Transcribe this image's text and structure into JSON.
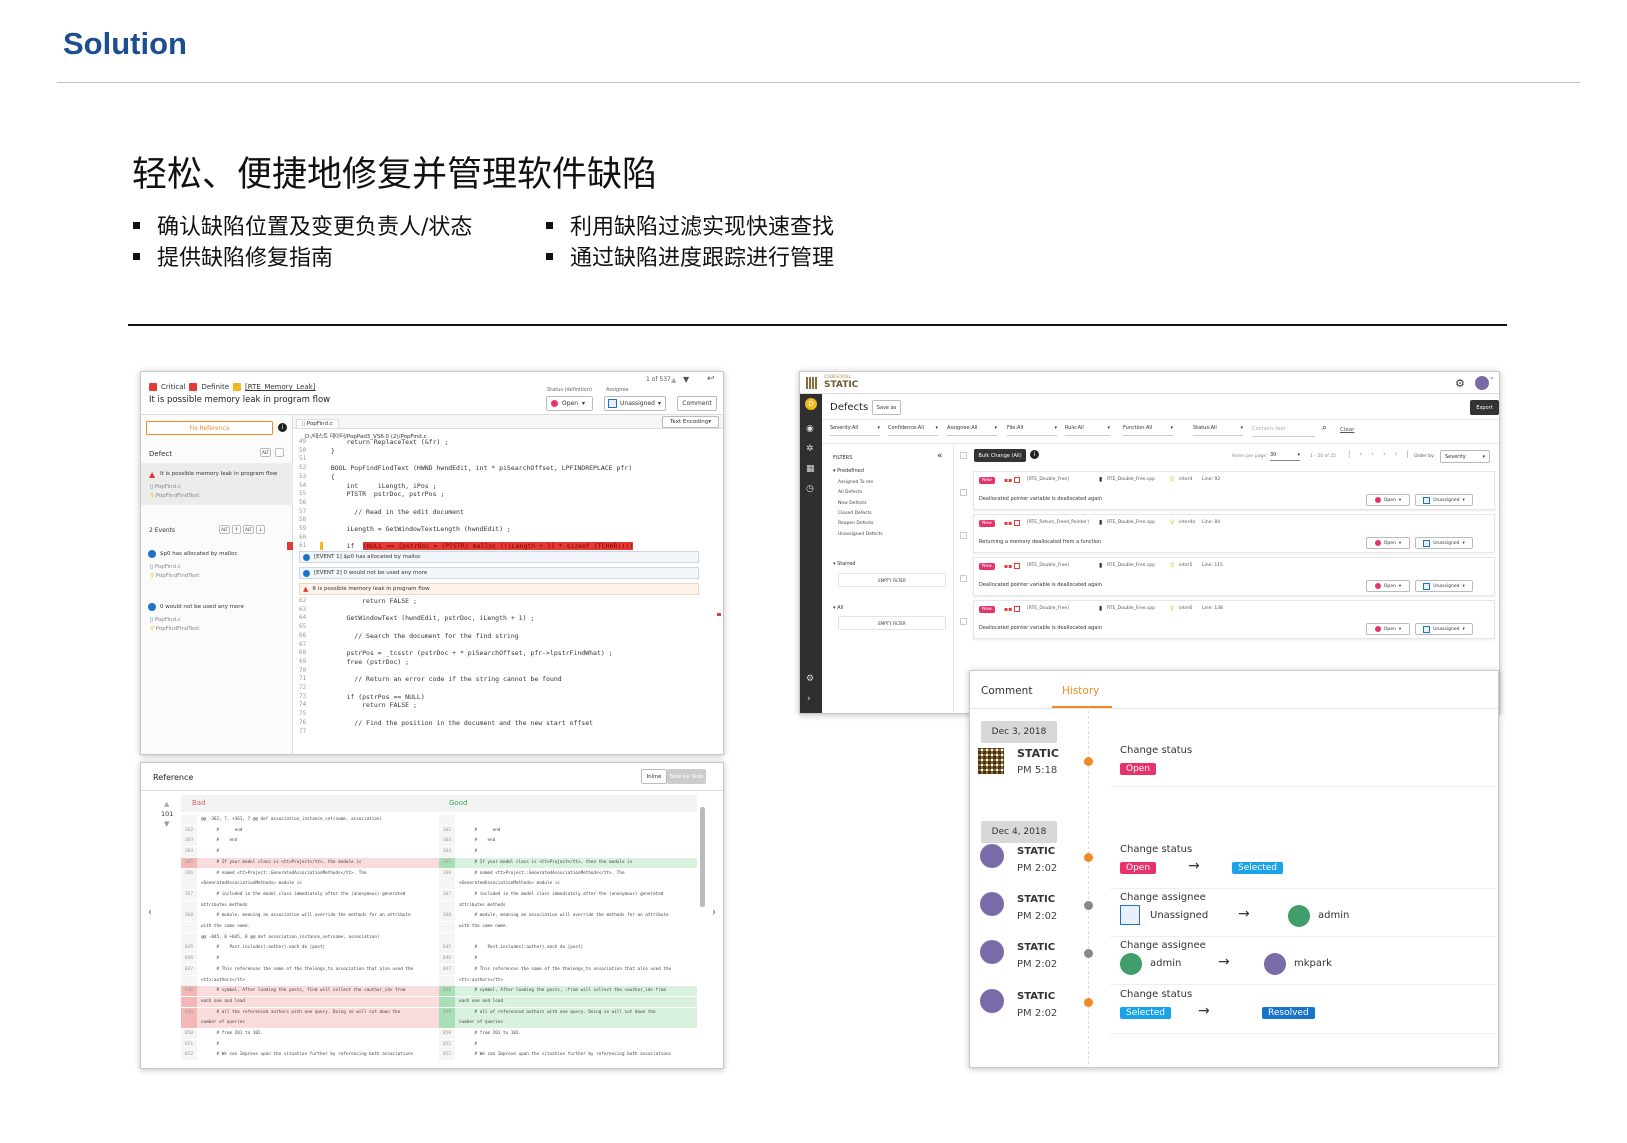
{
  "slide": {
    "title": "Solution",
    "headline": "轻松、便捷地修复并管理软件缺陷",
    "bullets": [
      "确认缺陷位置及变更负责人/状态",
      "提供缺陷修复指南",
      "利用缺陷过滤实现快速查找",
      "通过缺陷进度跟踪进行管理"
    ]
  },
  "left": {
    "tag_critical": "Critical",
    "tag_definite": "Definite",
    "checker": "[RTE_Memory_Leak]",
    "issue_title": "It is possible memory leak in program flow",
    "status_label": "Status",
    "status_sub": "(definition)",
    "assignee_label": "Assignee",
    "nav": "1 of 537",
    "status_value": "Open",
    "assignee_value": "Unassigned",
    "comment_btn": "Comment",
    "text_encoding": "Text Encoding",
    "fix_reference": "Fix Reference",
    "file_tab": "PopFind.c",
    "file_path": "D:/테스트 데이터/PopPad3_VS6.0 (2)/PopFind.c",
    "defect_label": "Defect",
    "defect_item": "It is possible memory leak in program flow",
    "file1": "PopFind.c",
    "func1": "PopFindFindText",
    "events_label": "2 Events",
    "event1": "$p0 has allocated by malloc",
    "file2": "PopFind.c",
    "func2": "PopFindFindText",
    "event2": "0 would not be used any more",
    "file3": "PopFind.c",
    "func3": "PopFindFindText",
    "code_top": [
      {
        "n": "49",
        "t": "      return ReplaceText (&fr) ;"
      },
      {
        "n": "50",
        "t": "  }"
      },
      {
        "n": "51",
        "t": ""
      },
      {
        "n": "52",
        "t": "  BOOL PopFindFindText (HWND hwndEdit, int * piSearchOffset, LPFINDREPLACE pfr)"
      },
      {
        "n": "53",
        "t": "  {"
      },
      {
        "n": "54",
        "t": "      int     iLength, iPos ;"
      },
      {
        "n": "55",
        "t": "      PTSTR  pstrDoc, pstrPos ;"
      },
      {
        "n": "56",
        "t": ""
      },
      {
        "n": "57",
        "t": "        // Read in the edit document"
      },
      {
        "n": "58",
        "t": ""
      },
      {
        "n": "59",
        "t": "      iLength = GetWindowTextLength (hwndEdit) ;"
      },
      {
        "n": "60",
        "t": ""
      }
    ],
    "line61_n": "61",
    "line61_if": "      if ",
    "line61_hl": "(NULL == (pstrDoc = (PTSTR) malloc ((iLength + 1) * sizeof (TCHAR))))",
    "evt_row1": "[EVENT 1] $p0 has allocated by malloc",
    "evt_row2": "[EVENT 2] 0 would not be used any more",
    "evt_row3": "It is possible memory leak in program flow",
    "code_bottom": [
      {
        "n": "62",
        "t": "          return FALSE ;"
      },
      {
        "n": "63",
        "t": ""
      },
      {
        "n": "64",
        "t": "      GetWindowText (hwndEdit, pstrDoc, iLength + 1) ;"
      },
      {
        "n": "65",
        "t": ""
      },
      {
        "n": "66",
        "t": "        // Search the document for the find string"
      },
      {
        "n": "67",
        "t": ""
      },
      {
        "n": "68",
        "t": "      pstrPos = _tcsstr (pstrDoc + * piSearchOffset, pfr->lpstrFindWhat) ;"
      },
      {
        "n": "69",
        "t": "      free (pstrDoc) ;"
      },
      {
        "n": "70",
        "t": ""
      },
      {
        "n": "71",
        "t": "        // Return an error code if the string cannot be found"
      },
      {
        "n": "72",
        "t": ""
      },
      {
        "n": "73",
        "t": "      if (pstrPos == NULL)"
      },
      {
        "n": "74",
        "t": "          return FALSE ;"
      },
      {
        "n": "75",
        "t": ""
      },
      {
        "n": "76",
        "t": "        // Find the position in the document and the new start offset"
      },
      {
        "n": "77",
        "t": ""
      }
    ],
    "ref_title": "Reference",
    "inline_btn": "Inline",
    "sbs_btn": "Side by Side",
    "counter": "101",
    "bad_label": "Bad",
    "good_label": "Good",
    "bad_rows": [
      {
        "n": "",
        "t": "@@ -362, 7, +361, 7 @@ def association_instance_set(name, association)",
        "c": "n"
      },
      {
        "n": "362",
        "t": "      #      end",
        "c": "n"
      },
      {
        "n": "363",
        "t": "      #    end",
        "c": "n"
      },
      {
        "n": "364",
        "t": "      #",
        "c": "n"
      },
      {
        "n": "365",
        "t": "      # If your model class is <tt>Project</tt>, the module is",
        "c": "d"
      },
      {
        "n": "366",
        "t": "      # named <tt>Project::GeneratedAssociationMethods</tt>. The",
        "c": "n"
      },
      {
        "n": "",
        "t": "<GeneratedAssociationMethods> module is",
        "c": "n"
      },
      {
        "n": "367",
        "t": "      # included in the model class immediately after the (anonymous) generated",
        "c": "n"
      },
      {
        "n": "",
        "t": "attributes methods",
        "c": "n"
      },
      {
        "n": "368",
        "t": "      # module, meaning an association will override the methods for an attribute",
        "c": "n"
      },
      {
        "n": "",
        "t": "with the same name.",
        "c": "n"
      },
      {
        "n": "",
        "t": "@@ -845, 8 +845, 8 @@ def association_instance_set(name, association)",
        "c": "n"
      },
      {
        "n": "845",
        "t": "      #    Post.includes(:author).each do |post|",
        "c": "n"
      },
      {
        "n": "846",
        "t": "      #",
        "c": "n"
      },
      {
        "n": "847",
        "t": "      # This references the name of the thelongs_to association that also used the",
        "c": "n"
      },
      {
        "n": "",
        "t": "<tt>:authors</tt>",
        "c": "n"
      },
      {
        "n": "848",
        "t": "      # symbol. After loading the posts, find will collect the <author_id> from",
        "c": "d"
      },
      {
        "n": "",
        "t": "each one and load",
        "c": "d"
      },
      {
        "n": "849",
        "t": "      # all the referenced authors with one query. Doing so will cut down the",
        "c": "d"
      },
      {
        "n": "",
        "t": "number of queries",
        "c": "d"
      },
      {
        "n": "850",
        "t": "      # from 201 to 102.",
        "c": "n"
      },
      {
        "n": "851",
        "t": "      #",
        "c": "n"
      },
      {
        "n": "852",
        "t": "      # We can Improve upon the situation further by referencing both associations",
        "c": "n"
      }
    ],
    "good_rows": [
      {
        "n": "",
        "t": "",
        "c": "n"
      },
      {
        "n": "362",
        "t": "      #      end",
        "c": "n"
      },
      {
        "n": "363",
        "t": "      #    end",
        "c": "n"
      },
      {
        "n": "364",
        "t": "      #",
        "c": "n"
      },
      {
        "n": "365",
        "t": "      # If your model class is <tt>Project</tt>, then the module is",
        "c": "a"
      },
      {
        "n": "366",
        "t": "      # named <tt>Project::GeneratedAssociationMethods</tt>. The",
        "c": "n"
      },
      {
        "n": "",
        "t": "<GeneratedAssociationMethods> module is",
        "c": "n"
      },
      {
        "n": "367",
        "t": "      # included in the model class immediately after the (anonymous) generated",
        "c": "n"
      },
      {
        "n": "",
        "t": "attributes methods",
        "c": "n"
      },
      {
        "n": "368",
        "t": "      # module, meaning an association will override the methods for an attribute",
        "c": "n"
      },
      {
        "n": "",
        "t": "with the same name.",
        "c": "n"
      },
      {
        "n": "",
        "t": "",
        "c": "n"
      },
      {
        "n": "845",
        "t": "      #    Post.includes(:author).each do |post|",
        "c": "n"
      },
      {
        "n": "846",
        "t": "      #",
        "c": "n"
      },
      {
        "n": "847",
        "t": "      # This references the name of the thelongs_to association that also used the",
        "c": "n"
      },
      {
        "n": "",
        "t": "<tt>:authors</tt>",
        "c": "n"
      },
      {
        "n": "848",
        "t": "      # symbol, After loading the posts, :from will collect the <author_id> from",
        "c": "a"
      },
      {
        "n": "",
        "t": "each one and load",
        "c": "a"
      },
      {
        "n": "849",
        "t": "      # all of referenced authors with one query. Doing so will cut down the",
        "c": "a"
      },
      {
        "n": "",
        "t": "number of queries",
        "c": "a"
      },
      {
        "n": "850",
        "t": "      # from 201 to 102.",
        "c": "n"
      },
      {
        "n": "851",
        "t": "      #",
        "c": "n"
      },
      {
        "n": "852",
        "t": "      # We can Improve upon the situation further by referencing both associations",
        "c": "n"
      }
    ]
  },
  "right": {
    "brand_small": "CODESCROLL",
    "brand": "STATIC",
    "page_title": "Defects",
    "save_as": "Save as",
    "export": "Export",
    "filters": [
      "Severity:All",
      "Confidence:All",
      "Assignee:All",
      "File:All",
      "Rule:All",
      "Function:All",
      "Status:All"
    ],
    "contains_placeholder": "Contains text",
    "clear": "Clear",
    "filters_label": "FILTERS",
    "bulk_change": "Bulk Change (All)",
    "items_per_page": "Items per page:",
    "per_page_value": "30",
    "range": "1 - 20 of 25",
    "order_by": "Order by:",
    "order_value": "Severity",
    "predefined": "Predefined",
    "predefined_items": [
      "Assigned To me",
      "All Defects",
      "New Defects",
      "Closed Defects",
      "Reopen Defects",
      "Unassigned Defects"
    ],
    "starred": "Starred",
    "empty_filter": "EMPTY FILTER",
    "all": "All",
    "empty_filter2": "EMPTY FILTER",
    "defects": [
      {
        "tag": "New",
        "checker": "[RTE_Double_Free]",
        "file": "RTE_Double_Free.cpp",
        "func": "inter4",
        "line": "Line: 92",
        "msg": "Deallocated pointer variable is deallocated again",
        "status": "Open",
        "assignee": "Unassigned"
      },
      {
        "tag": "New",
        "checker": "[RTE_Return_Freed_Pointer]",
        "file": "RTE_Double_Free.cpp",
        "func": "inter4a",
        "line": "Line: 84",
        "msg": "Returning a memory deallocated from a function",
        "status": "Open",
        "assignee": "Unassigned"
      },
      {
        "tag": "New",
        "checker": "[RTE_Double_Free]",
        "file": "RTE_Double_Free.cpp",
        "func": "inter5",
        "line": "Line: 115",
        "msg": "Deallocated pointer variable is deallocated again",
        "status": "Open",
        "assignee": "Unassigned"
      },
      {
        "tag": "New",
        "checker": "[RTE_Double_Free]",
        "file": "RTE_Double_Free.cpp",
        "func": "inter6",
        "line": "Line: 138",
        "msg": "Deallocated pointer variable is deallocated again",
        "status": "Open",
        "assignee": "Unassigned"
      }
    ],
    "tab_comment": "Comment",
    "tab_history": "History",
    "date1": "Dec 3, 2018",
    "date2": "Dec 4, 2018",
    "history": [
      {
        "user": "STATIC",
        "time": "PM 5:18",
        "action": "Change status",
        "from": "Open",
        "to": "",
        "dot": "#f08a24",
        "kind": "status1"
      },
      {
        "user": "STATIC",
        "time": "PM 2:02",
        "action": "Change status",
        "from": "Open",
        "to": "Selected",
        "dot": "#f08a24",
        "kind": "status"
      },
      {
        "user": "STATIC",
        "time": "PM 2:02",
        "action": "Change assignee",
        "from": "Unassigned",
        "to": "admin",
        "dot": "#888888",
        "kind": "assignee"
      },
      {
        "user": "STATIC",
        "time": "PM 2:02",
        "action": "Change assignee",
        "from": "admin",
        "to": "mkpark",
        "dot": "#888888",
        "kind": "assignee"
      },
      {
        "user": "STATIC",
        "time": "PM 2:02",
        "action": "Change status",
        "from": "Selected",
        "to": "Resolved",
        "dot": "#f08a24",
        "kind": "status"
      }
    ],
    "colors": {
      "open": "#e8336a",
      "selected": "#1aa3e8",
      "resolved": "#1a73c8",
      "brand": "#1d4e8f",
      "history_tab": "#f08a24",
      "defect_badge": "#e8336a"
    }
  }
}
